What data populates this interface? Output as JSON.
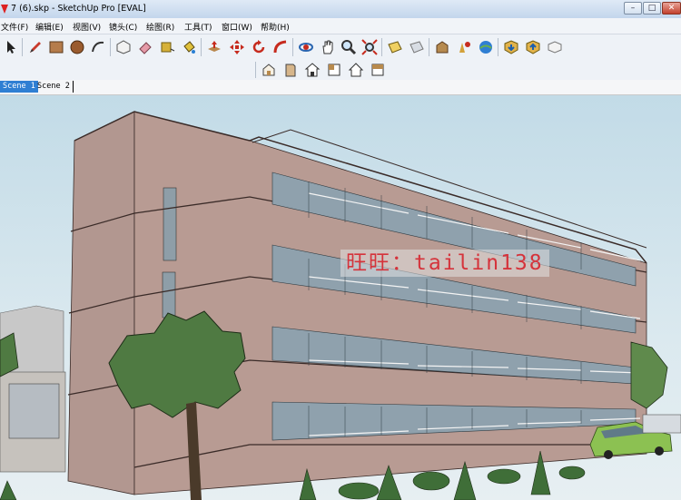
{
  "window": {
    "title": "7 (6).skp - SketchUp Pro [EVAL]",
    "controls": {
      "minimize": "–",
      "maximize": "□",
      "close": "✕"
    }
  },
  "menu": [
    "文件(F)",
    "编辑(E)",
    "视图(V)",
    "镜头(C)",
    "绘图(R)",
    "工具(T)",
    "窗口(W)",
    "帮助(H)"
  ],
  "toolbar": {
    "tools": [
      "select-icon",
      "pencil-icon",
      "rectangle-icon",
      "circle-icon",
      "arc-icon",
      "make-component-icon",
      "eraser-icon",
      "tape-measure-icon",
      "paint-bucket-icon",
      "push-pull-icon",
      "move-icon",
      "rotate-icon",
      "follow-me-icon",
      "orbit-icon",
      "pan-icon",
      "zoom-icon",
      "zoom-extents-icon",
      "section-plane-icon",
      "section-display-icon",
      "3d-warehouse-icon",
      "share-model-icon",
      "google-earth-icon",
      "get-models-icon",
      "share-component-icon",
      "photo-textures-icon"
    ],
    "views": [
      "iso-view-icon",
      "front-view-icon",
      "top-view-icon",
      "right-view-icon",
      "back-view-icon",
      "left-view-icon"
    ]
  },
  "scenes": [
    {
      "label": "Scene 1",
      "active": true
    },
    {
      "label": "Scene 2",
      "active": false
    }
  ],
  "viewport": {
    "watermark": "旺旺：tailin138",
    "colors": {
      "sky": "#cfe2ea",
      "facade": "#b69a92",
      "glass": "#8fa1ad",
      "tree": "#4f7a42",
      "car": "#8cc152"
    }
  }
}
